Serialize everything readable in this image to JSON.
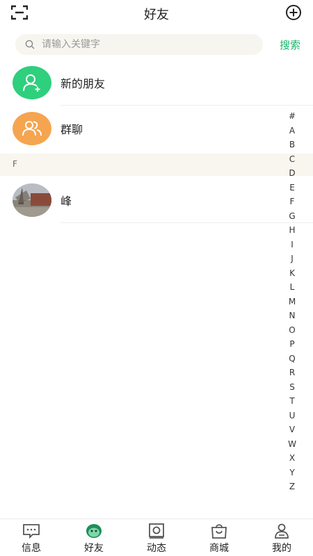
{
  "header": {
    "title": "好友"
  },
  "search": {
    "placeholder": "请输入关键字",
    "button_label": "搜索"
  },
  "entries": [
    {
      "label": "新的朋友",
      "icon": "add-user-icon",
      "color": "#2ecf7d"
    },
    {
      "label": "群聊",
      "icon": "group-icon",
      "color": "#f5a550"
    }
  ],
  "sections": [
    {
      "letter": "F",
      "contacts": [
        {
          "name": "峰"
        }
      ]
    }
  ],
  "index_letters": [
    "#",
    "A",
    "B",
    "C",
    "D",
    "E",
    "F",
    "G",
    "H",
    "I",
    "J",
    "K",
    "L",
    "M",
    "N",
    "O",
    "P",
    "Q",
    "R",
    "S",
    "T",
    "U",
    "V",
    "W",
    "X",
    "Y",
    "Z"
  ],
  "bottom_nav": [
    {
      "label": "信息",
      "icon": "message-icon"
    },
    {
      "label": "好友",
      "icon": "friends-icon",
      "active": true
    },
    {
      "label": "动态",
      "icon": "moments-icon"
    },
    {
      "label": "商城",
      "icon": "shop-bag-icon"
    },
    {
      "label": "我的",
      "icon": "profile-icon"
    }
  ],
  "colors": {
    "accent": "#19b46a",
    "new_friend": "#2ecf7d",
    "group": "#f5a550",
    "section_bg": "#f8f6ee"
  }
}
